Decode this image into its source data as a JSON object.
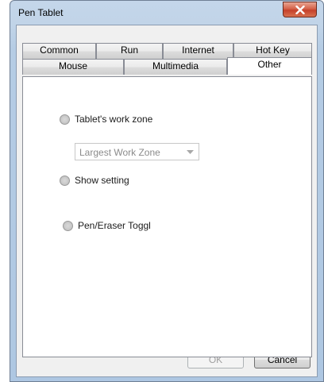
{
  "window": {
    "title": "Pen Tablet",
    "close_icon": "close-icon"
  },
  "tabs": {
    "row1": [
      "Common",
      "Run",
      "Internet",
      "Hot Key"
    ],
    "row2": [
      "Mouse",
      "Multimedia",
      "Other"
    ],
    "active": "Other"
  },
  "other_page": {
    "work_zone_label": "Tablet's work zone",
    "work_zone_dropdown": {
      "selected": "Largest Work Zone",
      "enabled": false
    },
    "show_setting_label": "Show setting",
    "pen_eraser_label": "Pen/Eraser Toggl"
  },
  "buttons": {
    "ok": "OK",
    "ok_enabled": false,
    "cancel": "Cancel"
  },
  "colors": {
    "titlebar": "#c1d4e8",
    "close_button": "#c5412a",
    "dialog_bg": "#f0f0f0"
  }
}
